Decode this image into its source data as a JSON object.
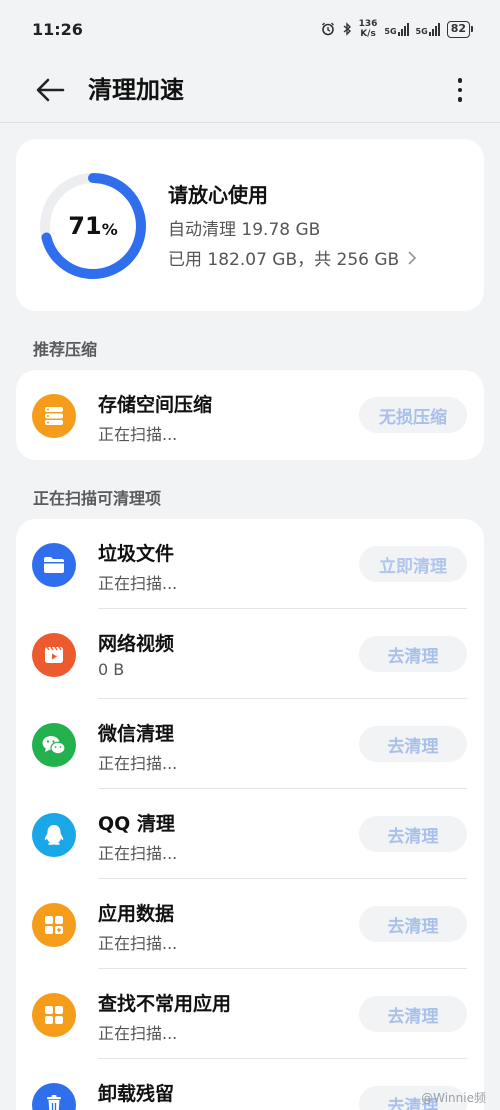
{
  "status_bar": {
    "time": "11:26",
    "speed_value": "136",
    "speed_unit": "K/s",
    "net1": "5G",
    "net2": "5G",
    "battery": "82"
  },
  "header": {
    "title": "清理加速"
  },
  "summary": {
    "percent": "71",
    "percent_sign": "%",
    "usage_fraction": 0.71,
    "title": "请放心使用",
    "auto_clean": "自动清理 19.78 GB",
    "used": "已用 182.07 GB，共 256 GB",
    "ring_color": "#2f6fed"
  },
  "recommend": {
    "label": "推荐压缩",
    "items": [
      {
        "name": "存储空间压缩",
        "sub": "正在扫描...",
        "action": "无损压缩",
        "icon": "storage-icon",
        "icon_color": "#f59c1a"
      }
    ]
  },
  "scan": {
    "label": "正在扫描可清理项",
    "items": [
      {
        "name": "垃圾文件",
        "sub": "正在扫描...",
        "action": "立即清理",
        "icon": "folder-icon",
        "icon_color": "#2f6fed"
      },
      {
        "name": "网络视频",
        "sub": "0 B",
        "action": "去清理",
        "icon": "video-icon",
        "icon_color": "#ec5a2e"
      },
      {
        "name": "微信清理",
        "sub": "正在扫描...",
        "action": "去清理",
        "icon": "wechat-icon",
        "icon_color": "#22b14c"
      },
      {
        "name": "QQ 清理",
        "sub": "正在扫描...",
        "action": "去清理",
        "icon": "qq-icon",
        "icon_color": "#1aa7e8"
      },
      {
        "name": "应用数据",
        "sub": "正在扫描...",
        "action": "去清理",
        "icon": "app-data-icon",
        "icon_color": "#f59c1a"
      },
      {
        "name": "查找不常用应用",
        "sub": "正在扫描...",
        "action": "去清理",
        "icon": "apps-icon",
        "icon_color": "#f59c1a"
      },
      {
        "name": "卸载残留",
        "sub": "",
        "action": "去清理",
        "icon": "trash-icon",
        "icon_color": "#2f6fed"
      }
    ]
  },
  "watermark": "@Winnie频"
}
